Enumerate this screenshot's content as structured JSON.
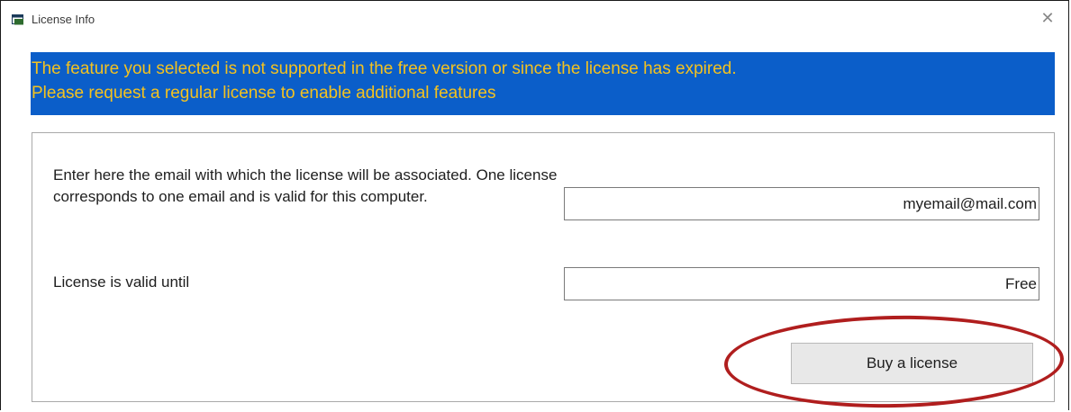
{
  "window": {
    "title": "License Info",
    "close_glyph": "✕"
  },
  "banner": {
    "line1": "The feature you selected is not supported in the free version or since the license has expired.",
    "line2": "Please request a regular license to enable additional features",
    "background_color": "#0b5ec9",
    "text_color": "#f4c21f"
  },
  "form": {
    "email_label": "Enter here the email with which the license will be associated. One license corresponds to one email and is valid for this computer.",
    "email_value": "myemail@mail.com",
    "valid_label": "License is valid until",
    "valid_value": "Free",
    "buy_button_label": "Buy a license"
  },
  "annotation": {
    "highlight_color": "#b01e1e"
  },
  "icons": {
    "app": "window-app-icon",
    "close": "close-icon"
  }
}
